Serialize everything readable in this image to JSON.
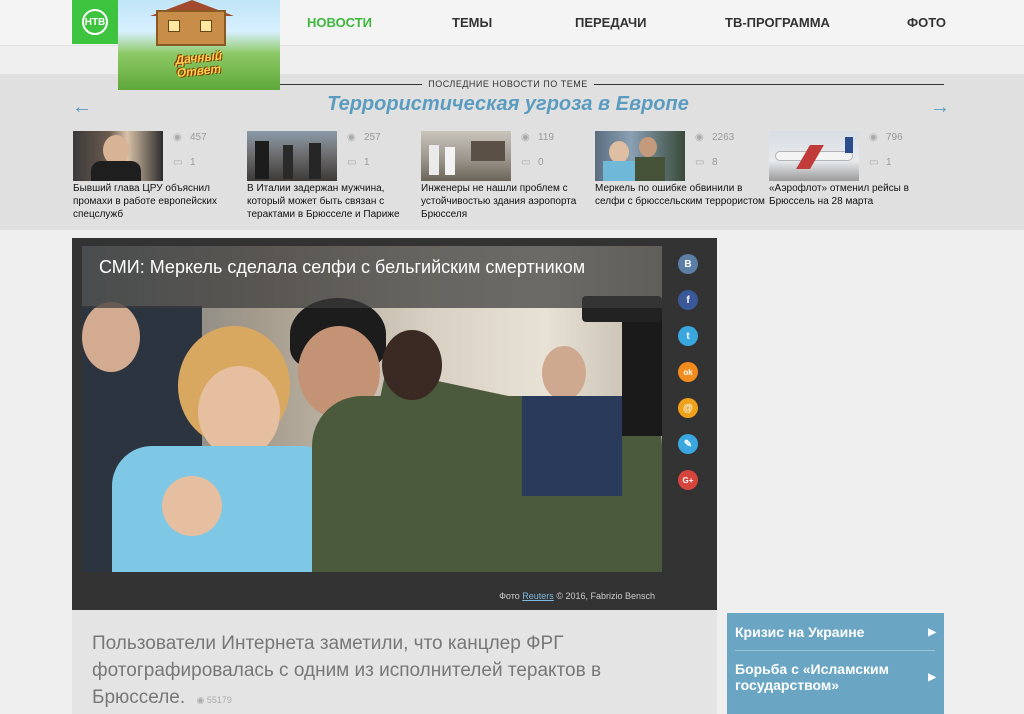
{
  "logo": {
    "text": "НТВ",
    "promo_label": "Дачный Ответ"
  },
  "nav": [
    "НОВОСТИ",
    "ТЕМЫ",
    "ПЕРЕДАЧИ",
    "ТВ-ПРОГРАММА",
    "ФОТО"
  ],
  "topic": {
    "kicker": "ПОСЛЕДНИЕ НОВОСТИ ПО ТЕМЕ",
    "title": "Террористическая угроза в Европе",
    "prev_icon": "arrow-left-icon",
    "next_icon": "arrow-right-icon",
    "cards": [
      {
        "views": "457",
        "comments": "1",
        "title": "Бывший глава ЦРУ объяснил промахи в работе европейских спецслужб"
      },
      {
        "views": "257",
        "comments": "1",
        "title": "В Италии задержан мужчина, который может быть связан с терактами в Брюсселе и Париже"
      },
      {
        "views": "119",
        "comments": "0",
        "title": "Инженеры не нашли проблем с устойчивостью здания аэропорта Брюсселя"
      },
      {
        "views": "2263",
        "comments": "8",
        "title": "Меркель по ошибке обвинили в селфи с брюссельским террористом"
      },
      {
        "views": "796",
        "comments": "1",
        "title": "«Аэрофлот» отменил рейсы в Брюссель на 28 марта"
      }
    ]
  },
  "article": {
    "headline": "СМИ: Меркель сделала селфи с бельгийским смертником",
    "credit_prefix": "Фото",
    "credit_link": "Reuters",
    "credit_suffix": "© 2016, Fabrizio Bensch",
    "lead": "Пользователи Интернета заметили, что канцлер ФРГ фотографировалась с одним из исполнителей терактов в Брюсселе.",
    "views": "55179"
  },
  "share": [
    {
      "icon": "vkontakte-icon",
      "glyph": "В",
      "color": "#5b7fa6"
    },
    {
      "icon": "facebook-icon",
      "glyph": "f",
      "color": "#3b5998"
    },
    {
      "icon": "twitter-icon",
      "glyph": "t",
      "color": "#3aa7df"
    },
    {
      "icon": "odnoklassniki-icon",
      "glyph": "ok",
      "color": "#f28c1e"
    },
    {
      "icon": "mailru-icon",
      "glyph": "@",
      "color": "#f0a21a"
    },
    {
      "icon": "livejournal-icon",
      "glyph": "✎",
      "color": "#3aa7df"
    },
    {
      "icon": "googleplus-icon",
      "glyph": "G+",
      "color": "#d6453b"
    }
  ],
  "side_topics": [
    {
      "label": "Кризис на Украине"
    },
    {
      "label": "Борьба с «Исламским государством»"
    }
  ]
}
